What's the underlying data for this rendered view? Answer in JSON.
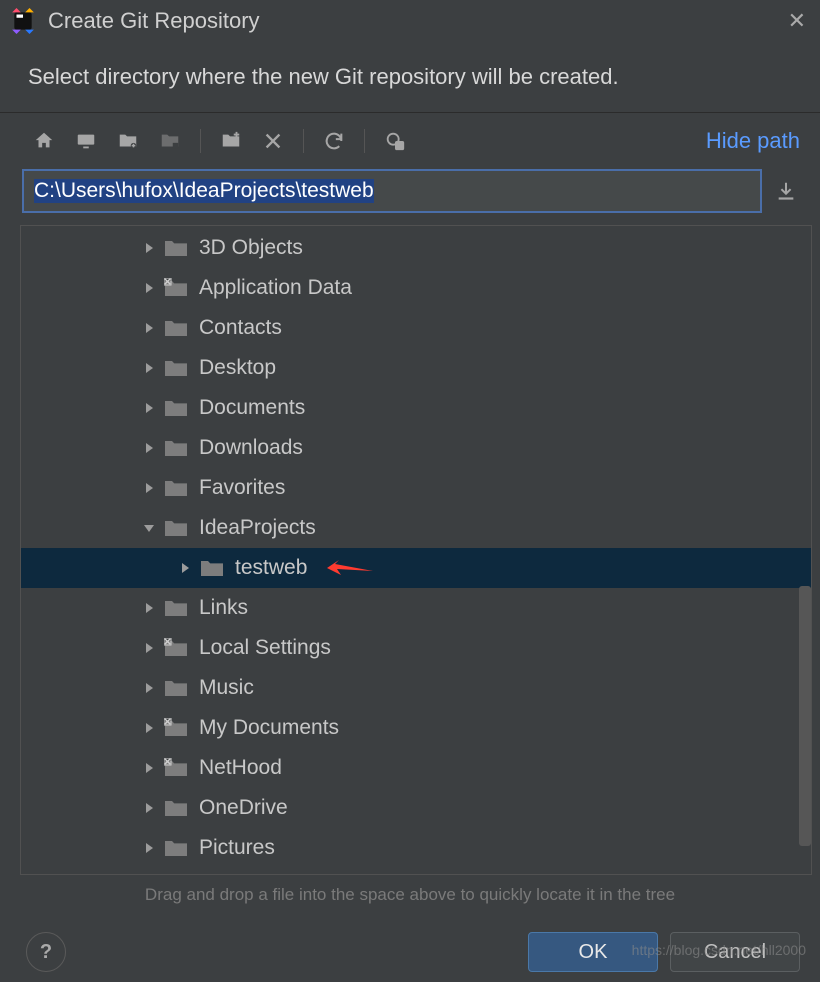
{
  "dialog": {
    "title": "Create Git Repository",
    "subtitle": "Select directory where the new Git repository will be created."
  },
  "toolbar": {
    "hide_path_label": "Hide path"
  },
  "path": {
    "value": "C:\\Users\\hufox\\IdeaProjects\\testweb"
  },
  "tree": {
    "items": [
      {
        "label": "3D Objects",
        "depth": 1,
        "expanded": false,
        "shortcut": false,
        "selected": false,
        "annotated": false
      },
      {
        "label": "Application Data",
        "depth": 1,
        "expanded": false,
        "shortcut": true,
        "selected": false,
        "annotated": false
      },
      {
        "label": "Contacts",
        "depth": 1,
        "expanded": false,
        "shortcut": false,
        "selected": false,
        "annotated": false
      },
      {
        "label": "Desktop",
        "depth": 1,
        "expanded": false,
        "shortcut": false,
        "selected": false,
        "annotated": false
      },
      {
        "label": "Documents",
        "depth": 1,
        "expanded": false,
        "shortcut": false,
        "selected": false,
        "annotated": false
      },
      {
        "label": "Downloads",
        "depth": 1,
        "expanded": false,
        "shortcut": false,
        "selected": false,
        "annotated": false
      },
      {
        "label": "Favorites",
        "depth": 1,
        "expanded": false,
        "shortcut": false,
        "selected": false,
        "annotated": false
      },
      {
        "label": "IdeaProjects",
        "depth": 1,
        "expanded": true,
        "shortcut": false,
        "selected": false,
        "annotated": false
      },
      {
        "label": "testweb",
        "depth": 2,
        "expanded": false,
        "shortcut": false,
        "selected": true,
        "annotated": true
      },
      {
        "label": "Links",
        "depth": 1,
        "expanded": false,
        "shortcut": false,
        "selected": false,
        "annotated": false
      },
      {
        "label": "Local Settings",
        "depth": 1,
        "expanded": false,
        "shortcut": true,
        "selected": false,
        "annotated": false
      },
      {
        "label": "Music",
        "depth": 1,
        "expanded": false,
        "shortcut": false,
        "selected": false,
        "annotated": false
      },
      {
        "label": "My Documents",
        "depth": 1,
        "expanded": false,
        "shortcut": true,
        "selected": false,
        "annotated": false
      },
      {
        "label": "NetHood",
        "depth": 1,
        "expanded": false,
        "shortcut": true,
        "selected": false,
        "annotated": false
      },
      {
        "label": "OneDrive",
        "depth": 1,
        "expanded": false,
        "shortcut": false,
        "selected": false,
        "annotated": false
      },
      {
        "label": "Pictures",
        "depth": 1,
        "expanded": false,
        "shortcut": false,
        "selected": false,
        "annotated": false
      }
    ]
  },
  "dragdrop_hint": "Drag and drop a file into the space above to quickly locate it in the tree",
  "footer": {
    "help_label": "?",
    "ok_label": "OK",
    "cancel_label": "Cancel"
  },
  "watermark": "https://blog.csdn.net/hll2000"
}
